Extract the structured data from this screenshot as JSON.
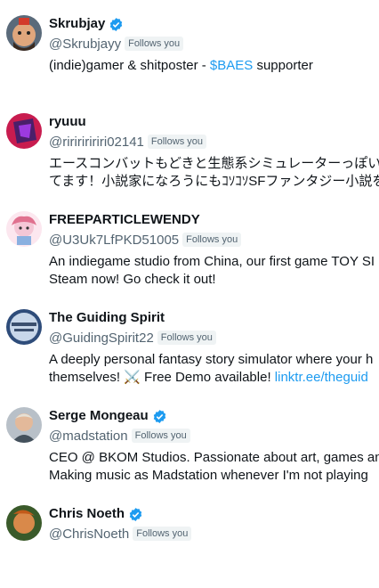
{
  "users": [
    {
      "name": "Skrubjay",
      "verified": true,
      "handle": "@Skrubjayy",
      "follows_label": "Follows you",
      "bio_lines": [
        {
          "pre": "(indie)gamer & shitposter - ",
          "link": "$BAES",
          "post": " supporter"
        }
      ]
    },
    {
      "name": "ryuuu",
      "verified": false,
      "handle": "@riririririri02141",
      "follows_label": "Follows you",
      "bio_lines": [
        {
          "pre": "エースコンバットもどきと生態系シミュレーターっぽい",
          "link": "",
          "post": ""
        },
        {
          "pre": "てます！小説家になろうにもｺｿｺｿSFファンタジー小説を",
          "link": "",
          "post": ""
        }
      ]
    },
    {
      "name": "FREEPARTICLEWENDY",
      "verified": false,
      "handle": "@U3Uk7LfPKD51005",
      "follows_label": "Follows you",
      "bio_lines": [
        {
          "pre": "An indiegame studio from China, our first game TOY SI",
          "link": "",
          "post": ""
        },
        {
          "pre": "Steam now! Go check it out!",
          "link": "",
          "post": ""
        }
      ]
    },
    {
      "name": "The Guiding Spirit",
      "verified": false,
      "handle": "@GuidingSpirit22",
      "follows_label": "Follows you",
      "bio_lines": [
        {
          "pre": "A deeply personal fantasy story simulator where your h",
          "link": "",
          "post": ""
        },
        {
          "pre": "themselves! ⚔️ Free Demo available! ",
          "link": "linktr.ee/theguid",
          "post": ""
        }
      ]
    },
    {
      "name": "Serge Mongeau",
      "verified": true,
      "handle": "@madstation",
      "follows_label": "Follows you",
      "bio_lines": [
        {
          "pre": "CEO @ BKOM Studios. Passionate about art, games an",
          "link": "",
          "post": ""
        },
        {
          "pre": "Making music as Madstation whenever I'm not playing",
          "link": "",
          "post": ""
        }
      ]
    },
    {
      "name": "Chris Noeth",
      "verified": true,
      "handle": "@ChrisNoeth",
      "follows_label": "Follows you",
      "bio_lines": []
    }
  ],
  "colors": {
    "text": "#0f1419",
    "secondary": "#536471",
    "link": "#1d9bf0",
    "badge_bg": "#eff3f4",
    "verified": "#1d9bf0"
  }
}
